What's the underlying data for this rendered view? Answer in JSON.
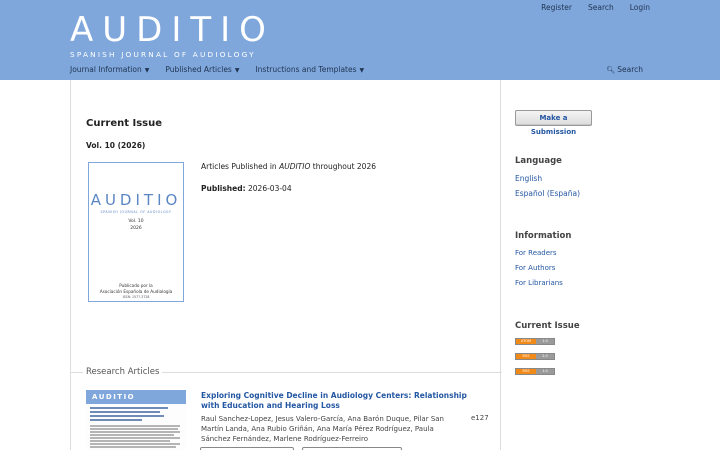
{
  "header": {
    "user_nav": [
      "Register",
      "Search",
      "Login"
    ],
    "logo_text": "AUDITIO",
    "logo_subtitle": "SPANISH JOURNAL OF AUDIOLOGY",
    "nav": [
      "Journal Information",
      "Published Articles",
      "Instructions and Templates"
    ],
    "search_label": "Search"
  },
  "main": {
    "heading": "Current Issue",
    "issue": "Vol. 10 (2026)",
    "cover": {
      "logo": "AUDITIO",
      "subtitle": "SPANISH JOURNAL OF AUDIOLOGY",
      "volume": "Vol. 10",
      "year": "2026",
      "publisher_line1": "Publicado por la",
      "publisher_line2": "Asociación Española de Audiología",
      "issn": "ISSN: 1577-3728"
    },
    "description_prefix": "Articles Published in ",
    "description_journal": "AUDITIO",
    "description_suffix": " throughout 2026",
    "published_label": "Published:",
    "published_date": "2026-03-04",
    "section_title": "Research Articles",
    "article": {
      "thumb_logo": "AUDITIO",
      "title": "Exploring Cognitive Decline in Audiology Centers: Relationship with Education and Hearing Loss",
      "authors": "Raul Sanchez-Lopez, Jesus Valero-García, Ana Barón Duque, Pilar San Martín Landa, Ana Rubio Griñán, Ana María Pérez Rodríguez, Paula Sánchez Fernández, Marlene Rodríguez-Ferreiro",
      "pages": "e127"
    }
  },
  "sidebar": {
    "submit_label": "Make a Submission",
    "language_title": "Language",
    "languages": [
      "English",
      "Español (España)"
    ],
    "information_title": "Information",
    "information_links": [
      "For Readers",
      "For Authors",
      "For Librarians"
    ],
    "current_issue_title": "Current Issue",
    "feeds": [
      {
        "left": "ATOM",
        "right": "1.0"
      },
      {
        "left": "RSS",
        "right": "2.0"
      },
      {
        "left": "RSS",
        "right": "1.0"
      }
    ]
  },
  "colors": {
    "header_bg": "#7fa7dc",
    "link": "#2457a3",
    "feed_orange": "#f28a1a"
  }
}
